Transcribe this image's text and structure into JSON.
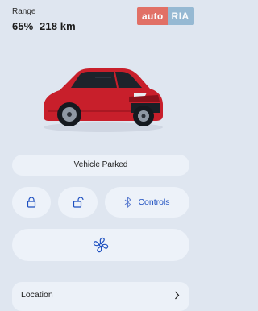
{
  "range": {
    "label": "Range",
    "percent": "65%",
    "distance": "218 km"
  },
  "watermark": {
    "part1": "auto",
    "part2": "RIA"
  },
  "vehicle": {
    "image": "red-suv-car",
    "status": "Vehicle Parked"
  },
  "actions": {
    "lock_icon": "lock-icon",
    "unlock_icon": "unlock-icon",
    "controls_icon": "bluetooth-icon",
    "controls_label": "Controls",
    "climate_icon": "fan-icon"
  },
  "location": {
    "label": "Location",
    "icon": "chevron-right-icon"
  },
  "colors": {
    "background": "#dfe6f0",
    "surface": "#ecf1f8",
    "accent": "#1d4fc0",
    "car": "#c81f2b"
  }
}
